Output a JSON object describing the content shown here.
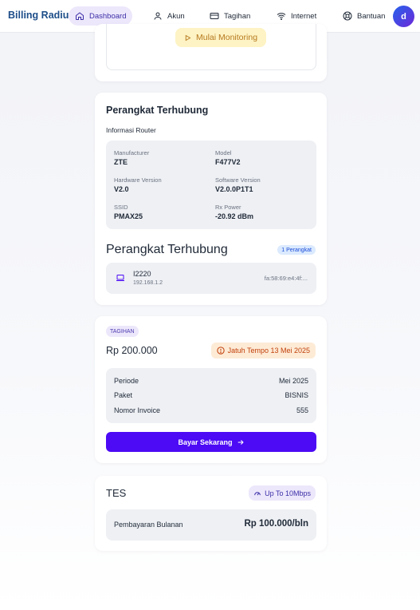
{
  "nav": {
    "brand": "Billing Radius",
    "items": [
      {
        "label": "Dashboard",
        "icon": "home-icon"
      },
      {
        "label": "Akun",
        "icon": "user-icon"
      },
      {
        "label": "Tagihan",
        "icon": "card-icon"
      },
      {
        "label": "Internet",
        "icon": "wifi-icon"
      },
      {
        "label": "Bantuan",
        "icon": "lifebuoy-icon"
      }
    ],
    "avatar": "d",
    "active": "Dashboard"
  },
  "monitor": {
    "button_label": "Mulai Monitoring",
    "icon": "play-icon"
  },
  "router": {
    "title": "Perangkat Terhubung",
    "subtitle": "Informasi Router",
    "fields": [
      {
        "label": "Manufacturer",
        "value": "ZTE"
      },
      {
        "label": "Model",
        "value": "F477V2"
      },
      {
        "label": "Hardware Version",
        "value": "V2.0"
      },
      {
        "label": "Software Version",
        "value": "V2.0.0P1T1"
      },
      {
        "label": "SSID",
        "value": "PMAX25"
      },
      {
        "label": "Rx Power",
        "value": "-20.92 dBm"
      }
    ],
    "devices_title": "Perangkat Terhubung",
    "devices_count": "1 Perangkat",
    "devices": [
      {
        "name": "I2220",
        "ip": "192.168.1.2",
        "mac": "fa:58:69:e4:4f:...",
        "icon": "laptop-icon"
      }
    ]
  },
  "bill": {
    "tag": "TAGIHAN",
    "amount": "Rp 200.000",
    "due": "Jatuh Tempo 13 Mei 2025",
    "rows": [
      {
        "label": "Periode",
        "value": "Mei 2025"
      },
      {
        "label": "Paket",
        "value": "BISNIS"
      },
      {
        "label": "Nomor Invoice",
        "value": "555"
      }
    ],
    "pay_button": "Bayar Sekarang",
    "colors": {
      "primary": "#4c0af5",
      "due": "#c2410c"
    }
  },
  "package": {
    "name": "TES",
    "speed": "Up To 10Mbps",
    "price_label": "Pembayaran Bulanan",
    "price": "Rp 100.000/bln"
  }
}
